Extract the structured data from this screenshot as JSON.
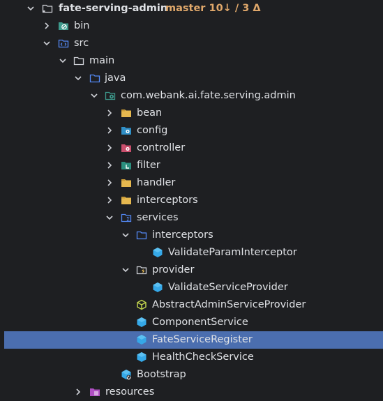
{
  "project": {
    "name": "fate-serving-admin",
    "vcs": "master 10↓ / 3 Δ"
  },
  "tree": {
    "bin": "bin",
    "src": "src",
    "main": "main",
    "java": "java",
    "package": "com.webank.ai.fate.serving.admin",
    "bean": "bean",
    "config": "config",
    "controller": "controller",
    "filter": "filter",
    "handler": "handler",
    "interceptors": "interceptors",
    "services": "services",
    "services_interceptors": "interceptors",
    "validate_param_interceptor": "ValidateParamInterceptor",
    "provider": "provider",
    "validate_service_provider": "ValidateServiceProvider",
    "abstract_admin_service_provider": "AbstractAdminServiceProvider",
    "component_service": "ComponentService",
    "fate_service_register": "FateServiceRegister",
    "health_check_service": "HealthCheckService",
    "bootstrap": "Bootstrap",
    "resources": "resources"
  },
  "colors": {
    "background": "#1e1f22",
    "selection": "#4b6eaf",
    "text": "#dfe1e5",
    "vcs": "#e0a86b",
    "folder": "#e6b84f",
    "interface": "#35a8e8"
  }
}
